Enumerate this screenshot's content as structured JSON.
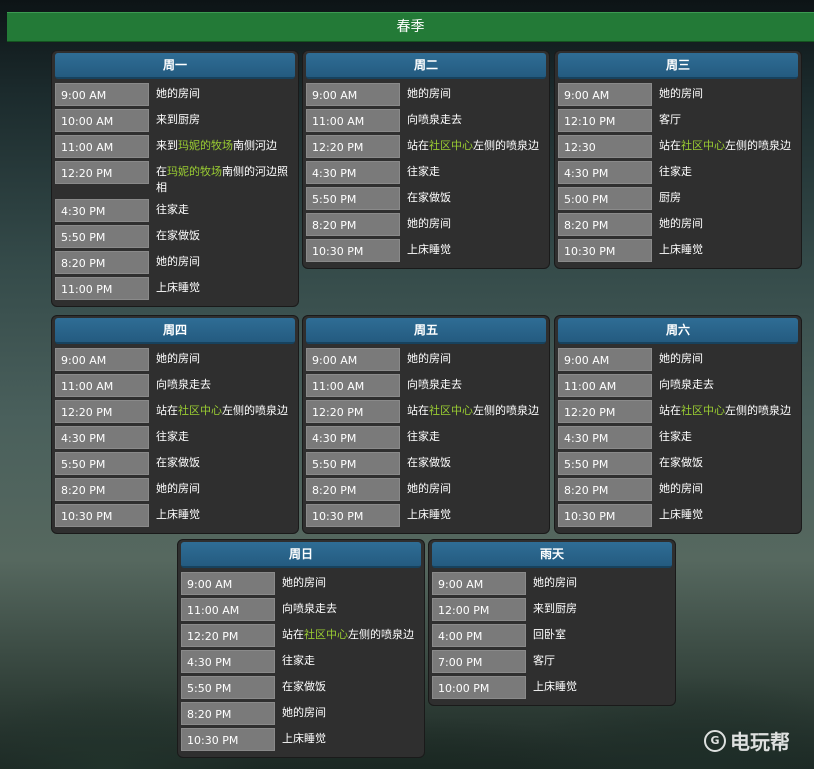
{
  "season_title": "春季",
  "watermark": "电玩帮",
  "highlight_color": "#9acd32",
  "days": [
    {
      "name": "周一",
      "entries": [
        {
          "time": "9:00 AM",
          "place": [
            {
              "t": "她的房间"
            }
          ]
        },
        {
          "time": "10:00 AM",
          "place": [
            {
              "t": "来到厨房"
            }
          ]
        },
        {
          "time": "11:00 AM",
          "place": [
            {
              "t": "来到"
            },
            {
              "t": "玛妮的牧场",
              "hl": true
            },
            {
              "t": "南侧河边"
            }
          ]
        },
        {
          "time": "12:20 PM",
          "place": [
            {
              "t": "在"
            },
            {
              "t": "玛妮的牧场",
              "hl": true
            },
            {
              "t": "南侧的河边照相"
            }
          ]
        },
        {
          "time": "4:30 PM",
          "place": [
            {
              "t": "往家走"
            }
          ]
        },
        {
          "time": "5:50 PM",
          "place": [
            {
              "t": "在家做饭"
            }
          ]
        },
        {
          "time": "8:20 PM",
          "place": [
            {
              "t": "她的房间"
            }
          ]
        },
        {
          "time": "11:00 PM",
          "place": [
            {
              "t": "上床睡觉"
            }
          ]
        }
      ]
    },
    {
      "name": "周二",
      "entries": [
        {
          "time": "9:00 AM",
          "place": [
            {
              "t": "她的房间"
            }
          ]
        },
        {
          "time": "11:00 AM",
          "place": [
            {
              "t": "向喷泉走去"
            }
          ]
        },
        {
          "time": "12:20 PM",
          "place": [
            {
              "t": "站在"
            },
            {
              "t": "社区中心",
              "hl": true
            },
            {
              "t": "左侧的喷泉边"
            }
          ]
        },
        {
          "time": "4:30 PM",
          "place": [
            {
              "t": "往家走"
            }
          ]
        },
        {
          "time": "5:50 PM",
          "place": [
            {
              "t": "在家做饭"
            }
          ]
        },
        {
          "time": "8:20 PM",
          "place": [
            {
              "t": "她的房间"
            }
          ]
        },
        {
          "time": "10:30 PM",
          "place": [
            {
              "t": "上床睡觉"
            }
          ]
        }
      ]
    },
    {
      "name": "周三",
      "entries": [
        {
          "time": "9:00 AM",
          "place": [
            {
              "t": "她的房间"
            }
          ]
        },
        {
          "time": "12:10 PM",
          "place": [
            {
              "t": "客厅"
            }
          ]
        },
        {
          "time": "12:30",
          "place": [
            {
              "t": "站在"
            },
            {
              "t": "社区中心",
              "hl": true
            },
            {
              "t": "左侧的喷泉边"
            }
          ]
        },
        {
          "time": "4:30 PM",
          "place": [
            {
              "t": "往家走"
            }
          ]
        },
        {
          "time": "5:00 PM",
          "place": [
            {
              "t": "厨房"
            }
          ]
        },
        {
          "time": "8:20 PM",
          "place": [
            {
              "t": "她的房间"
            }
          ]
        },
        {
          "time": "10:30 PM",
          "place": [
            {
              "t": "上床睡觉"
            }
          ]
        }
      ]
    },
    {
      "name": "周四",
      "entries": [
        {
          "time": "9:00 AM",
          "place": [
            {
              "t": "她的房间"
            }
          ]
        },
        {
          "time": "11:00 AM",
          "place": [
            {
              "t": "向喷泉走去"
            }
          ]
        },
        {
          "time": "12:20 PM",
          "place": [
            {
              "t": "站在"
            },
            {
              "t": "社区中心",
              "hl": true
            },
            {
              "t": "左侧的喷泉边"
            }
          ]
        },
        {
          "time": "4:30 PM",
          "place": [
            {
              "t": "往家走"
            }
          ]
        },
        {
          "time": "5:50 PM",
          "place": [
            {
              "t": "在家做饭"
            }
          ]
        },
        {
          "time": "8:20 PM",
          "place": [
            {
              "t": "她的房间"
            }
          ]
        },
        {
          "time": "10:30 PM",
          "place": [
            {
              "t": "上床睡觉"
            }
          ]
        }
      ]
    },
    {
      "name": "周五",
      "entries": [
        {
          "time": "9:00 AM",
          "place": [
            {
              "t": "她的房间"
            }
          ]
        },
        {
          "time": "11:00 AM",
          "place": [
            {
              "t": "向喷泉走去"
            }
          ]
        },
        {
          "time": "12:20 PM",
          "place": [
            {
              "t": "站在"
            },
            {
              "t": "社区中心",
              "hl": true
            },
            {
              "t": "左侧的喷泉边"
            }
          ]
        },
        {
          "time": "4:30 PM",
          "place": [
            {
              "t": "往家走"
            }
          ]
        },
        {
          "time": "5:50 PM",
          "place": [
            {
              "t": "在家做饭"
            }
          ]
        },
        {
          "time": "8:20 PM",
          "place": [
            {
              "t": "她的房间"
            }
          ]
        },
        {
          "time": "10:30 PM",
          "place": [
            {
              "t": "上床睡觉"
            }
          ]
        }
      ]
    },
    {
      "name": "周六",
      "entries": [
        {
          "time": "9:00 AM",
          "place": [
            {
              "t": "她的房间"
            }
          ]
        },
        {
          "time": "11:00 AM",
          "place": [
            {
              "t": "向喷泉走去"
            }
          ]
        },
        {
          "time": "12:20 PM",
          "place": [
            {
              "t": "站在"
            },
            {
              "t": "社区中心",
              "hl": true
            },
            {
              "t": "左侧的喷泉边"
            }
          ]
        },
        {
          "time": "4:30 PM",
          "place": [
            {
              "t": "往家走"
            }
          ]
        },
        {
          "time": "5:50 PM",
          "place": [
            {
              "t": "在家做饭"
            }
          ]
        },
        {
          "time": "8:20 PM",
          "place": [
            {
              "t": "她的房间"
            }
          ]
        },
        {
          "time": "10:30 PM",
          "place": [
            {
              "t": "上床睡觉"
            }
          ]
        }
      ]
    },
    {
      "name": "周日",
      "entries": [
        {
          "time": "9:00 AM",
          "place": [
            {
              "t": "她的房间"
            }
          ]
        },
        {
          "time": "11:00 AM",
          "place": [
            {
              "t": "向喷泉走去"
            }
          ]
        },
        {
          "time": "12:20 PM",
          "place": [
            {
              "t": "站在"
            },
            {
              "t": "社区中心",
              "hl": true
            },
            {
              "t": "左侧的喷泉边"
            }
          ]
        },
        {
          "time": "4:30 PM",
          "place": [
            {
              "t": "往家走"
            }
          ]
        },
        {
          "time": "5:50 PM",
          "place": [
            {
              "t": "在家做饭"
            }
          ]
        },
        {
          "time": "8:20 PM",
          "place": [
            {
              "t": "她的房间"
            }
          ]
        },
        {
          "time": "10:30 PM",
          "place": [
            {
              "t": "上床睡觉"
            }
          ]
        }
      ]
    },
    {
      "name": "雨天",
      "entries": [
        {
          "time": "9:00 AM",
          "place": [
            {
              "t": "她的房间"
            }
          ]
        },
        {
          "time": "12:00 PM",
          "place": [
            {
              "t": "来到厨房"
            }
          ]
        },
        {
          "time": "4:00 PM",
          "place": [
            {
              "t": "回卧室"
            }
          ]
        },
        {
          "time": "7:00 PM",
          "place": [
            {
              "t": "客厅"
            }
          ]
        },
        {
          "time": "10:00 PM",
          "place": [
            {
              "t": "上床睡觉"
            }
          ]
        }
      ]
    }
  ]
}
